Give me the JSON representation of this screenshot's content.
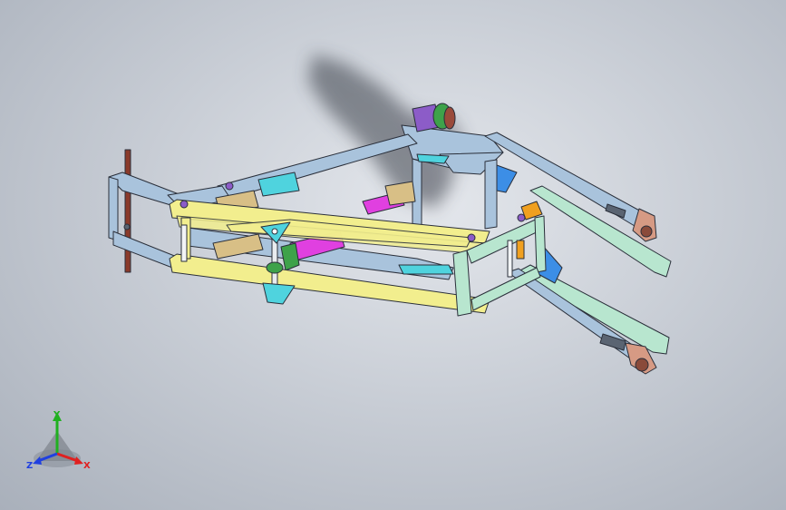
{
  "viewport": {
    "background_colors": [
      "#e4e7ec",
      "#a9b0bb"
    ]
  },
  "model": {
    "part_colors": {
      "frame_steel": "#a9c3dc",
      "upper_arms": "#f2ee8e",
      "side_frame": "#b8e6cf",
      "cyan_brackets": "#4fd3de",
      "actuator": "#e040e0",
      "wood_block": "#d8bf86",
      "orange_pin": "#f0a020",
      "purple_bolt": "#8c5cc8",
      "green_knob": "#3ea24a",
      "red_rod": "#8a3a2a",
      "copper_plate": "#d69a84",
      "blue_gusset": "#3c8ee6"
    }
  },
  "triad": {
    "x_label": "X",
    "y_label": "Y",
    "z_label": "Z",
    "x_color": "#e02020",
    "y_color": "#20b020",
    "z_color": "#2040e0"
  }
}
